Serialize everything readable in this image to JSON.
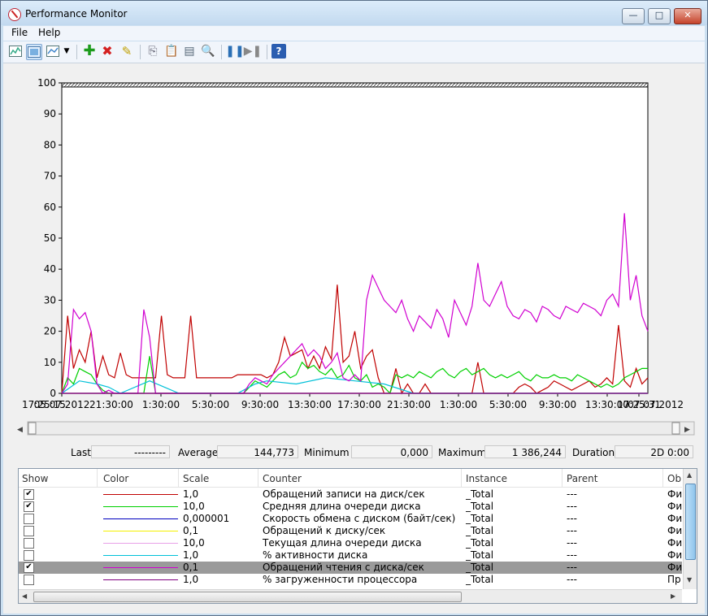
{
  "window": {
    "title": "Performance Monitor",
    "minimize_glyph": "—",
    "maximize_glyph": "□",
    "close_glyph": "✕"
  },
  "menu": {
    "items": [
      "File",
      "Help"
    ]
  },
  "toolbar": {
    "icons": [
      "view-graph-icon",
      "view-current-activity-icon",
      "change-graph-type-icon",
      "dropdown-arrow-icon",
      "add-counter-icon",
      "delete-counter-icon",
      "highlight-icon",
      "copy-properties-icon",
      "paste-counter-list-icon",
      "properties-icon",
      "zoom-icon",
      "freeze-display-icon",
      "update-data-icon",
      "help-icon"
    ]
  },
  "colors": {
    "red": "#c00000",
    "green": "#00d000",
    "blue": "#0000c0",
    "yellow": "#f5f000",
    "pink": "#e8a0e8",
    "cyan": "#00c0d8",
    "magenta": "#d000d0",
    "purple": "#800080",
    "selected_row": "#9a9a9a"
  },
  "chart_data": {
    "type": "line",
    "title": "",
    "ylim": [
      0,
      100
    ],
    "y_ticks": [
      "0",
      "10",
      "20",
      "30",
      "40",
      "50",
      "60",
      "70",
      "80",
      "90",
      "100"
    ],
    "x_ticks": [
      "17:25:15",
      "05.07.2012",
      "21:30:00",
      "1:30:00",
      "5:30:00",
      "9:30:00",
      "13:30:00",
      "17:30:00",
      "21:30:00",
      "1:30:00",
      "5:30:00",
      "9:30:00",
      "13:30:00",
      "17:25:31",
      "07.07.2012"
    ],
    "grid": false,
    "series": [
      {
        "name": "Обращений записи на диск/сек",
        "color": "#c00000",
        "x": [
          0,
          1,
          2,
          3,
          4,
          5,
          6,
          7,
          8,
          9,
          10,
          11,
          12,
          13,
          14,
          15,
          16,
          17,
          18,
          19,
          20,
          21,
          22,
          23,
          24,
          25,
          26,
          27,
          28,
          29,
          30,
          31,
          32,
          33,
          34,
          35,
          36,
          37,
          38,
          39,
          40,
          41,
          42,
          43,
          44,
          45,
          46,
          47,
          48,
          49,
          50,
          51,
          52,
          53,
          54,
          55,
          56,
          57,
          58,
          59,
          60,
          61,
          62,
          63,
          64,
          65,
          66,
          67,
          68,
          69,
          70,
          71,
          72,
          73,
          74,
          75,
          76,
          77,
          78,
          79,
          80,
          81,
          82,
          83,
          84,
          85,
          86,
          87,
          88,
          89,
          90,
          91,
          92,
          93,
          94,
          95,
          96,
          97,
          98,
          99,
          100
        ],
        "y": [
          0,
          25,
          8,
          14,
          10,
          20,
          5,
          12,
          6,
          5,
          13,
          6,
          5,
          5,
          5,
          5,
          5,
          25,
          6,
          5,
          5,
          5,
          25,
          5,
          5,
          5,
          5,
          5,
          5,
          5,
          6,
          6,
          6,
          6,
          6,
          5,
          6,
          10,
          18,
          12,
          13,
          14,
          8,
          12,
          8,
          15,
          11,
          35,
          10,
          12,
          20,
          8,
          12,
          14,
          5,
          0,
          0,
          8,
          0,
          3,
          0,
          0,
          3,
          0,
          0,
          0,
          0,
          0,
          0,
          0,
          0,
          10,
          0,
          0,
          0,
          0,
          0,
          0,
          2,
          3,
          2,
          0,
          1,
          2,
          4,
          3,
          2,
          1,
          2,
          3,
          4,
          2,
          3,
          5,
          3,
          22,
          4,
          2,
          8,
          3,
          5
        ]
      },
      {
        "name": "Средняя длина очереди диска",
        "color": "#00d000",
        "x": [
          0,
          1,
          2,
          3,
          4,
          5,
          6,
          7,
          8,
          9,
          10,
          11,
          12,
          13,
          14,
          15,
          16,
          17,
          18,
          19,
          20,
          21,
          22,
          23,
          24,
          25,
          26,
          27,
          28,
          29,
          30,
          31,
          32,
          33,
          34,
          35,
          36,
          37,
          38,
          39,
          40,
          41,
          42,
          43,
          44,
          45,
          46,
          47,
          48,
          49,
          50,
          51,
          52,
          53,
          54,
          55,
          56,
          57,
          58,
          59,
          60,
          61,
          62,
          63,
          64,
          65,
          66,
          67,
          68,
          69,
          70,
          71,
          72,
          73,
          74,
          75,
          76,
          77,
          78,
          79,
          80,
          81,
          82,
          83,
          84,
          85,
          86,
          87,
          88,
          89,
          90,
          91,
          92,
          93,
          94,
          95,
          96,
          97,
          98,
          99,
          100
        ],
        "y": [
          0,
          5,
          3,
          8,
          7,
          6,
          3,
          1,
          0,
          0,
          0,
          0,
          0,
          0,
          0,
          12,
          0,
          0,
          0,
          0,
          0,
          0,
          0,
          0,
          0,
          0,
          0,
          0,
          0,
          0,
          0,
          0,
          2,
          4,
          3,
          2,
          4,
          6,
          7,
          5,
          6,
          10,
          8,
          9,
          7,
          6,
          8,
          5,
          6,
          9,
          5,
          4,
          6,
          2,
          3,
          2,
          0,
          6,
          5,
          6,
          5,
          7,
          6,
          5,
          7,
          8,
          6,
          5,
          7,
          8,
          6,
          7,
          8,
          6,
          5,
          6,
          5,
          6,
          7,
          5,
          4,
          6,
          5,
          5,
          6,
          5,
          5,
          4,
          6,
          5,
          4,
          3,
          2,
          3,
          2,
          3,
          5,
          6,
          7,
          8,
          8
        ]
      },
      {
        "name": "Скорость обмена с диском (байт/сек)",
        "color": "#0000c0",
        "x": [
          0,
          50,
          100
        ],
        "y": [
          0,
          0,
          0
        ]
      },
      {
        "name": "Обращений к диску/сек",
        "color": "#f5f000",
        "x": [
          0,
          50,
          100
        ],
        "y": [
          0,
          0,
          0
        ]
      },
      {
        "name": "Текущая длина очереди диска",
        "color": "#e8a0e8",
        "x": [
          0,
          50,
          100
        ],
        "y": [
          0,
          0,
          0
        ]
      },
      {
        "name": "% активности диска",
        "color": "#00c0d8",
        "x": [
          0,
          3,
          6,
          8,
          10,
          15,
          20,
          30,
          33,
          35,
          40,
          45,
          50,
          55,
          60,
          70,
          80,
          90,
          100
        ],
        "y": [
          0,
          4,
          3,
          2,
          0,
          4,
          0,
          0,
          3,
          4,
          3,
          5,
          4,
          3,
          0,
          0,
          0,
          0,
          0
        ]
      },
      {
        "name": "Обращений чтения с диска/сек",
        "color": "#d000d0",
        "x": [
          0,
          1,
          2,
          3,
          4,
          5,
          6,
          7,
          8,
          9,
          10,
          11,
          12,
          13,
          14,
          15,
          16,
          17,
          18,
          19,
          20,
          21,
          22,
          23,
          24,
          25,
          26,
          27,
          28,
          29,
          30,
          31,
          32,
          33,
          34,
          35,
          36,
          37,
          38,
          39,
          40,
          41,
          42,
          43,
          44,
          45,
          46,
          47,
          48,
          49,
          50,
          51,
          52,
          53,
          54,
          55,
          56,
          57,
          58,
          59,
          60,
          61,
          62,
          63,
          64,
          65,
          66,
          67,
          68,
          69,
          70,
          71,
          72,
          73,
          74,
          75,
          76,
          77,
          78,
          79,
          80,
          81,
          82,
          83,
          84,
          85,
          86,
          87,
          88,
          89,
          90,
          91,
          92,
          93,
          94,
          95,
          96,
          97,
          98,
          99,
          100
        ],
        "y": [
          0,
          3,
          27,
          24,
          26,
          20,
          3,
          0,
          1,
          0,
          0,
          0,
          0,
          0,
          27,
          18,
          0,
          0,
          0,
          0,
          0,
          0,
          0,
          0,
          0,
          0,
          0,
          0,
          0,
          0,
          0,
          0,
          3,
          5,
          4,
          3,
          6,
          8,
          10,
          12,
          14,
          16,
          12,
          14,
          12,
          8,
          10,
          13,
          5,
          4,
          6,
          4,
          30,
          38,
          34,
          30,
          28,
          26,
          30,
          24,
          20,
          25,
          23,
          21,
          27,
          24,
          18,
          30,
          26,
          22,
          28,
          42,
          30,
          28,
          32,
          36,
          28,
          25,
          24,
          27,
          26,
          23,
          28,
          27,
          25,
          24,
          28,
          27,
          26,
          29,
          28,
          27,
          25,
          30,
          32,
          28,
          58,
          30,
          38,
          25,
          20
        ]
      },
      {
        "name": "% загруженности процессора",
        "color": "#800080",
        "x": [
          0,
          50,
          100
        ],
        "y": [
          0,
          0,
          0
        ]
      }
    ]
  },
  "stats": {
    "last_label": "Last",
    "last_value": "---------",
    "average_label": "Average",
    "average_value": "144,773",
    "minimum_label": "Minimum",
    "minimum_value": "0,000",
    "maximum_label": "Maximum",
    "maximum_value": "1 386,244",
    "duration_label": "Duration",
    "duration_value": "2D 0:00"
  },
  "legend": {
    "columns": [
      "Show",
      "Color",
      "Scale",
      "Counter",
      "Instance",
      "Parent",
      "Ob"
    ],
    "rows": [
      {
        "show": true,
        "color": "#c00000",
        "scale": "1,0",
        "counter": "Обращений записи на диск/сек",
        "instance": "_Total",
        "parent": "---",
        "object": "Фи",
        "selected": false
      },
      {
        "show": true,
        "color": "#00d000",
        "scale": "10,0",
        "counter": "Средняя длина очереди диска",
        "instance": "_Total",
        "parent": "---",
        "object": "Фи",
        "selected": false
      },
      {
        "show": false,
        "color": "#0000c0",
        "scale": "0,000001",
        "counter": "Скорость обмена с диском (байт/сек)",
        "instance": "_Total",
        "parent": "---",
        "object": "Фи",
        "selected": false
      },
      {
        "show": false,
        "color": "#f5f000",
        "scale": "0,1",
        "counter": "Обращений к диску/сек",
        "instance": "_Total",
        "parent": "---",
        "object": "Фи",
        "selected": false
      },
      {
        "show": false,
        "color": "#e8a0e8",
        "scale": "10,0",
        "counter": "Текущая длина очереди диска",
        "instance": "_Total",
        "parent": "---",
        "object": "Фи",
        "selected": false
      },
      {
        "show": false,
        "color": "#00c0d8",
        "scale": "1,0",
        "counter": "% активности диска",
        "instance": "_Total",
        "parent": "---",
        "object": "Фи",
        "selected": false
      },
      {
        "show": true,
        "color": "#d000d0",
        "scale": "0,1",
        "counter": "Обращений чтения с диска/сек",
        "instance": "_Total",
        "parent": "---",
        "object": "Фи",
        "selected": true
      },
      {
        "show": false,
        "color": "#800080",
        "scale": "1,0",
        "counter": "% загруженности процессора",
        "instance": "_Total",
        "parent": "---",
        "object": "Пр",
        "selected": false
      }
    ]
  }
}
